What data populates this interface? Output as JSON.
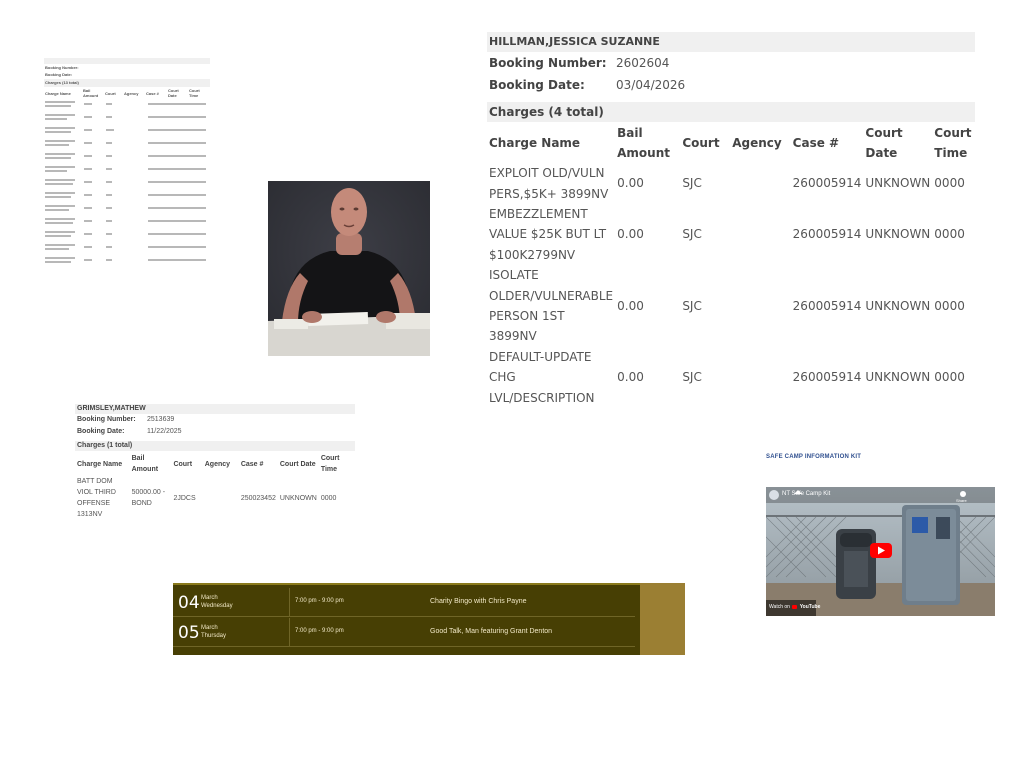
{
  "large_record": {
    "name": "HILLMAN,JESSICA SUZANNE",
    "booking_number_label": "Booking Number:",
    "booking_number": "2602604",
    "booking_date_label": "Booking Date:",
    "booking_date": "03/04/2026",
    "charges_header": "Charges (4 total)",
    "columns": [
      "Charge Name",
      "Bail Amount",
      "Court",
      "Agency",
      "Case #",
      "Court Date",
      "Court Time"
    ],
    "rows": [
      {
        "charge": "EXPLOIT OLD/VULN PERS,$5K+ 3899NV",
        "bail": "0.00",
        "court": "SJC",
        "agency": "",
        "case": "260005914",
        "date": "UNKNOWN",
        "time": "0000"
      },
      {
        "charge": "EMBEZZLEMENT VALUE $25K BUT LT $100K2799NV",
        "bail": "0.00",
        "court": "SJC",
        "agency": "",
        "case": "260005914",
        "date": "UNKNOWN",
        "time": "0000"
      },
      {
        "charge": "ISOLATE OLDER/VULNERABLE PERSON 1ST 3899NV",
        "bail": "0.00",
        "court": "SJC",
        "agency": "",
        "case": "260005914",
        "date": "UNKNOWN",
        "time": "0000"
      },
      {
        "charge": "DEFAULT-UPDATE CHG LVL/DESCRIPTION",
        "bail": "0.00",
        "court": "SJC",
        "agency": "",
        "case": "260005914",
        "date": "UNKNOWN",
        "time": "0000"
      }
    ]
  },
  "tiny_record": {
    "name": "",
    "booking_number_label": "Booking Number:",
    "booking_number": "",
    "booking_date_label": "Booking Date:",
    "booking_date": "",
    "charges_header": "Charges (13 total)",
    "columns": [
      "Charge Name",
      "Bail Amount",
      "Court",
      "Agency",
      "Case #",
      "Court Date",
      "Court Time"
    ]
  },
  "mid_record": {
    "name": "GRIMSLEY,MATHEW",
    "booking_number_label": "Booking Number:",
    "booking_number": "2513639",
    "booking_date_label": "Booking Date:",
    "booking_date": "11/22/2025",
    "charges_header": "Charges (1 total)",
    "columns": [
      "Charge Name",
      "Bail Amount",
      "Court",
      "Agency",
      "Case #",
      "Court Date",
      "Court Time"
    ],
    "rows": [
      {
        "charge": "BATT DOM VIOL THIRD OFFENSE 1313NV",
        "bail": "50000.00 - BOND",
        "court": "2JDCS",
        "agency": "",
        "case": "250023452",
        "date": "UNKNOWN",
        "time": "0000"
      }
    ]
  },
  "events": [
    {
      "day": "04",
      "month": "March",
      "weekday": "Wednesday",
      "time": "7:00 pm - 9:00 pm",
      "title": "Charity Bingo with Chris Payne"
    },
    {
      "day": "05",
      "month": "March",
      "weekday": "Thursday",
      "time": "7:00 pm - 9:00 pm",
      "title": "Good Talk, Man featuring Grant Denton"
    }
  ],
  "safe_camp": {
    "title": "SAFE CAMP INFORMATION KIT",
    "video_title": "NT Safe Camp Kit",
    "watch_on": "Watch on",
    "youtube": "YouTube",
    "share": "Share"
  },
  "colors": {
    "event_bg": "#473f04",
    "event_gold": "#9b7f33",
    "kit_title": "#2f4f8f",
    "youtube_red": "#ff0000"
  }
}
